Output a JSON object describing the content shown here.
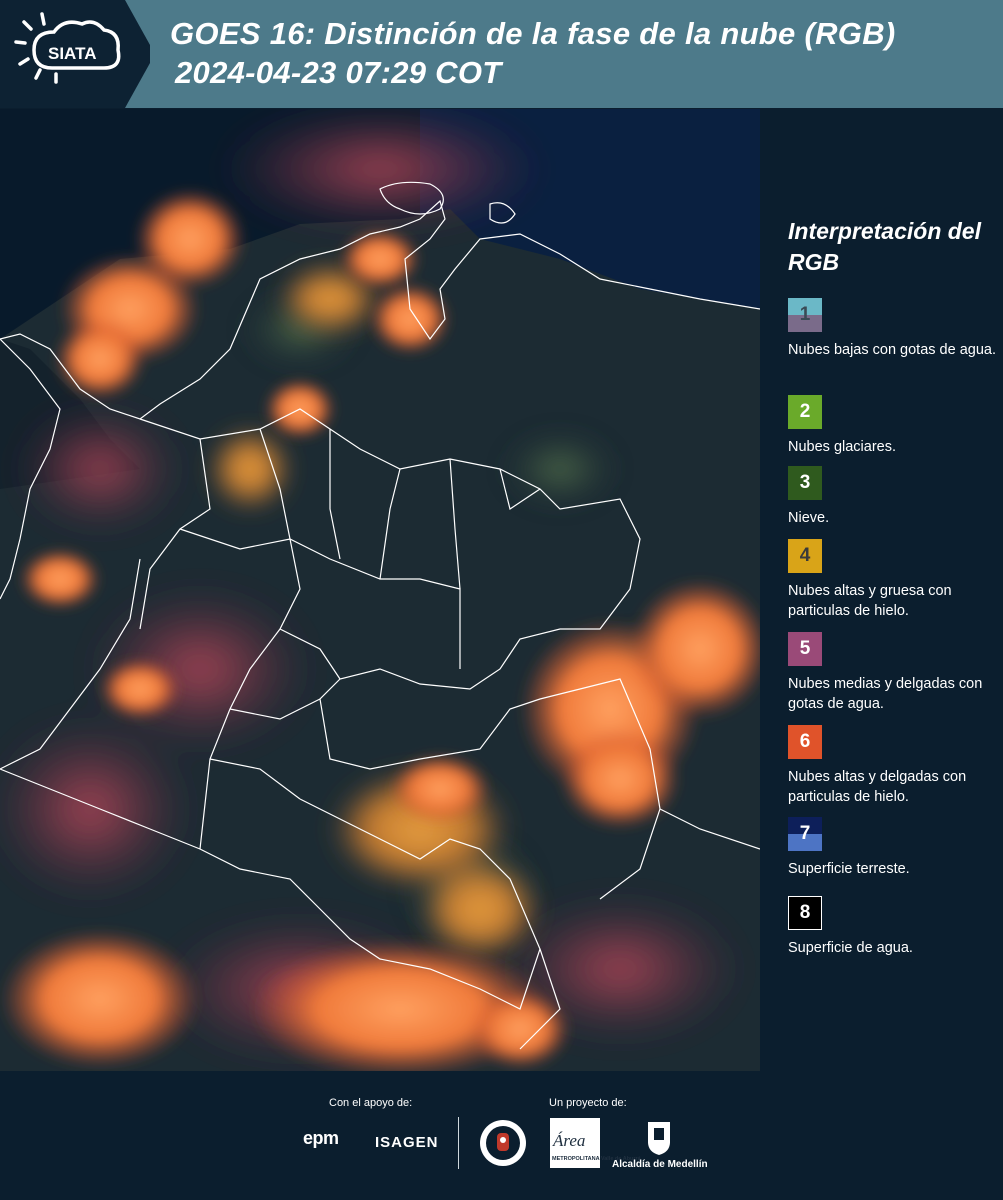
{
  "header": {
    "logo_text": "SIATA",
    "title_line1": "GOES 16: Distinción de la fase de la nube (RGB)",
    "title_line2": "2024-04-23 07:29 COT"
  },
  "map": {
    "description_icon": "satellite-map",
    "colors": {
      "ocean": "#081a2b",
      "land": "#1a2a35",
      "borders": "#ffffff"
    }
  },
  "legend": {
    "title": "Interpretación del RGB",
    "items": [
      {
        "number": "1",
        "label": "Nubes bajas con gotas de agua.",
        "color_top": "#6bb8c7",
        "color_bottom": "#7a6b8a",
        "number_color": "#3a4a55"
      },
      {
        "number": "2",
        "label": "Nubes glaciares.",
        "color_top": "#6aaa2a",
        "color_bottom": "#6aaa2a",
        "number_color": "#ffffff"
      },
      {
        "number": "3",
        "label": "Nieve.",
        "color_top": "#2f5a1e",
        "color_bottom": "#2f5a1e",
        "number_color": "#ffffff"
      },
      {
        "number": "4",
        "label": "Nubes altas y gruesa con particulas de hielo.",
        "color_top": "#d9a418",
        "color_bottom": "#d9a418",
        "number_color": "#3a3a3a"
      },
      {
        "number": "5",
        "label": "Nubes medias y delgadas con gotas de agua.",
        "color_top": "#9a4a78",
        "color_bottom": "#9a4a78",
        "number_color": "#ffffff"
      },
      {
        "number": "6",
        "label": "Nubes altas y delgadas con particulas de hielo.",
        "color_top": "#e0532a",
        "color_bottom": "#e0532a",
        "number_color": "#ffffff"
      },
      {
        "number": "7",
        "label": "Superficie terreste.",
        "color_top": "#0d1f5a",
        "color_bottom": "#4d74c4",
        "number_color": "#ffffff"
      },
      {
        "number": "8",
        "label": "Superficie de agua.",
        "color_top": "#000000",
        "color_bottom": "#000000",
        "number_color": "#ffffff"
      }
    ]
  },
  "footer": {
    "support_label": "Con el apoyo de:",
    "project_label": "Un proyecto de:",
    "epm": "epm",
    "isagen": "ISAGEN",
    "area_logo": "Área",
    "area_sub": "METROPOLITANA Valle de Aburrá",
    "alcaldia": "Alcaldía de Medellín"
  }
}
